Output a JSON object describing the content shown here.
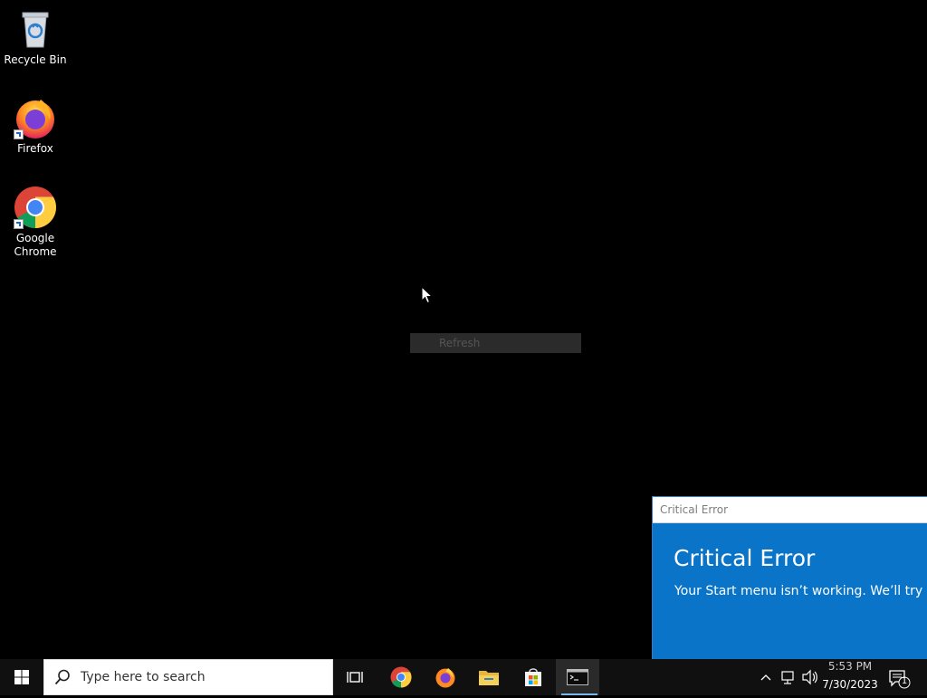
{
  "desktop": {
    "icons": [
      {
        "label": "Recycle Bin",
        "icon": "recycle-bin-icon"
      },
      {
        "label": "Firefox",
        "icon": "firefox-icon"
      },
      {
        "label": "Google Chrome",
        "icon": "chrome-icon"
      }
    ]
  },
  "context_menu": {
    "item": "Refresh"
  },
  "error_popup": {
    "window_title": "Critical Error",
    "heading": "Critical Error",
    "message": "Your Start menu isn’t working. We’ll try to fix it the next time you sign in."
  },
  "taskbar": {
    "search_placeholder": "Type here to search",
    "apps": [
      "task-view-icon",
      "chrome-icon",
      "firefox-icon",
      "file-explorer-icon",
      "store-icon",
      "terminal-icon"
    ],
    "clock": {
      "time": "5:53 PM",
      "date": "7/30/2023"
    },
    "notification_count": "1"
  },
  "colors": {
    "error_blue": "#0a74c9",
    "taskbar": "#101010",
    "accent": "#76b9ed"
  }
}
